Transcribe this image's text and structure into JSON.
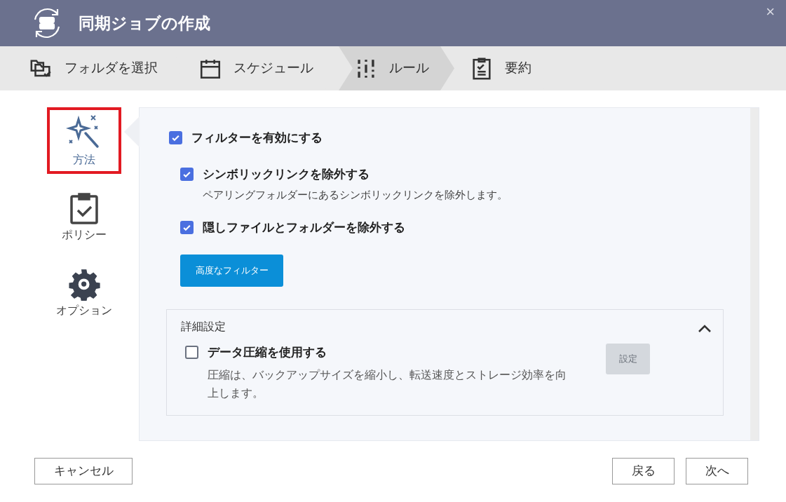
{
  "window": {
    "title": "同期ジョブの作成",
    "close": "×"
  },
  "steps": [
    {
      "kind": "folder",
      "label": "フォルダを選択",
      "selected": false
    },
    {
      "kind": "calendar",
      "label": "スケジュール",
      "selected": false
    },
    {
      "kind": "sliders",
      "label": "ルール",
      "selected": true
    },
    {
      "kind": "summary",
      "label": "要約",
      "selected": false
    }
  ],
  "sidebar": {
    "items": [
      {
        "kind": "wand",
        "label": "方法",
        "selected": true
      },
      {
        "kind": "clipboard",
        "label": "ポリシー",
        "selected": false
      },
      {
        "kind": "gear",
        "label": "オプション",
        "selected": false
      }
    ]
  },
  "filter": {
    "label": "フィルターを有効にする",
    "checked": true,
    "options": [
      {
        "label": "シンボリックリンクを除外する",
        "description": "ペアリングフォルダーにあるシンボリックリンクを除外します。",
        "checked": true
      },
      {
        "label": "隠しファイルとフォルダーを除外する",
        "checked": true
      }
    ],
    "advanced_button": "高度なフィルター"
  },
  "advanced": {
    "title": "詳細設定",
    "expanded": true,
    "compression": {
      "label": "データ圧縮を使用する",
      "description": "圧縮は、バックアップサイズを縮小し、転送速度とストレージ効率を向上します。",
      "checked": false,
      "button": "設定",
      "button_disabled": true
    }
  },
  "footer": {
    "cancel": "キャンセル",
    "back": "戻る",
    "next": "次へ"
  }
}
